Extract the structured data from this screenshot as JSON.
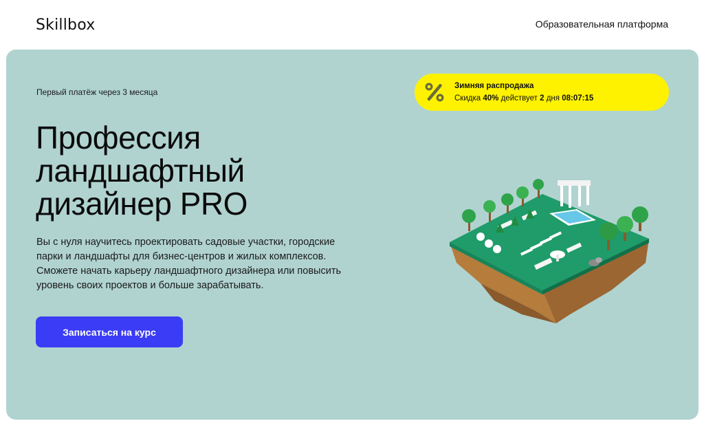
{
  "header": {
    "logo": "Skillbox",
    "platform_link": "Образовательная платформа"
  },
  "hero": {
    "installment_note": "Первый платёж через 3 месяца",
    "title": "Профессия ландшафтный дизайнер PRO",
    "description": "Вы с нуля научитесь проектировать садовые участки, городские парки и ландшафты для бизнес-центров и жилых комплексов. Сможете начать карьеру ландшафтного дизайнера или повысить уровень своих проектов и больше зарабатывать.",
    "cta_label": "Записаться на курс",
    "background_color": "#b0d3d0",
    "cta_color": "#3b3cf5"
  },
  "promo": {
    "title": "Зимняя распродажа",
    "discount_prefix": "Скидка",
    "discount_value": "40%",
    "discount_middle": "действует",
    "days_value": "2",
    "days_word": "дня",
    "timer": "08:07:15",
    "icon": "percent-icon",
    "color": "#fef200"
  },
  "illustration": {
    "icon": "landscape-island-illustration"
  }
}
